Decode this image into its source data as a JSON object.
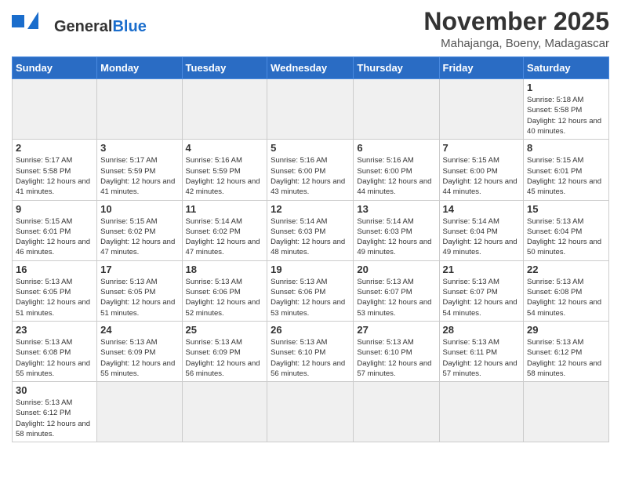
{
  "logo": {
    "text_general": "General",
    "text_blue": "Blue"
  },
  "title": {
    "month_year": "November 2025",
    "location": "Mahajanga, Boeny, Madagascar"
  },
  "weekdays": [
    "Sunday",
    "Monday",
    "Tuesday",
    "Wednesday",
    "Thursday",
    "Friday",
    "Saturday"
  ],
  "weeks": [
    [
      {
        "day": "",
        "info": ""
      },
      {
        "day": "",
        "info": ""
      },
      {
        "day": "",
        "info": ""
      },
      {
        "day": "",
        "info": ""
      },
      {
        "day": "",
        "info": ""
      },
      {
        "day": "",
        "info": ""
      },
      {
        "day": "1",
        "info": "Sunrise: 5:18 AM\nSunset: 5:58 PM\nDaylight: 12 hours and 40 minutes."
      }
    ],
    [
      {
        "day": "2",
        "info": "Sunrise: 5:17 AM\nSunset: 5:58 PM\nDaylight: 12 hours and 41 minutes."
      },
      {
        "day": "3",
        "info": "Sunrise: 5:17 AM\nSunset: 5:59 PM\nDaylight: 12 hours and 41 minutes."
      },
      {
        "day": "4",
        "info": "Sunrise: 5:16 AM\nSunset: 5:59 PM\nDaylight: 12 hours and 42 minutes."
      },
      {
        "day": "5",
        "info": "Sunrise: 5:16 AM\nSunset: 6:00 PM\nDaylight: 12 hours and 43 minutes."
      },
      {
        "day": "6",
        "info": "Sunrise: 5:16 AM\nSunset: 6:00 PM\nDaylight: 12 hours and 44 minutes."
      },
      {
        "day": "7",
        "info": "Sunrise: 5:15 AM\nSunset: 6:00 PM\nDaylight: 12 hours and 44 minutes."
      },
      {
        "day": "8",
        "info": "Sunrise: 5:15 AM\nSunset: 6:01 PM\nDaylight: 12 hours and 45 minutes."
      }
    ],
    [
      {
        "day": "9",
        "info": "Sunrise: 5:15 AM\nSunset: 6:01 PM\nDaylight: 12 hours and 46 minutes."
      },
      {
        "day": "10",
        "info": "Sunrise: 5:15 AM\nSunset: 6:02 PM\nDaylight: 12 hours and 47 minutes."
      },
      {
        "day": "11",
        "info": "Sunrise: 5:14 AM\nSunset: 6:02 PM\nDaylight: 12 hours and 47 minutes."
      },
      {
        "day": "12",
        "info": "Sunrise: 5:14 AM\nSunset: 6:03 PM\nDaylight: 12 hours and 48 minutes."
      },
      {
        "day": "13",
        "info": "Sunrise: 5:14 AM\nSunset: 6:03 PM\nDaylight: 12 hours and 49 minutes."
      },
      {
        "day": "14",
        "info": "Sunrise: 5:14 AM\nSunset: 6:04 PM\nDaylight: 12 hours and 49 minutes."
      },
      {
        "day": "15",
        "info": "Sunrise: 5:13 AM\nSunset: 6:04 PM\nDaylight: 12 hours and 50 minutes."
      }
    ],
    [
      {
        "day": "16",
        "info": "Sunrise: 5:13 AM\nSunset: 6:05 PM\nDaylight: 12 hours and 51 minutes."
      },
      {
        "day": "17",
        "info": "Sunrise: 5:13 AM\nSunset: 6:05 PM\nDaylight: 12 hours and 51 minutes."
      },
      {
        "day": "18",
        "info": "Sunrise: 5:13 AM\nSunset: 6:06 PM\nDaylight: 12 hours and 52 minutes."
      },
      {
        "day": "19",
        "info": "Sunrise: 5:13 AM\nSunset: 6:06 PM\nDaylight: 12 hours and 53 minutes."
      },
      {
        "day": "20",
        "info": "Sunrise: 5:13 AM\nSunset: 6:07 PM\nDaylight: 12 hours and 53 minutes."
      },
      {
        "day": "21",
        "info": "Sunrise: 5:13 AM\nSunset: 6:07 PM\nDaylight: 12 hours and 54 minutes."
      },
      {
        "day": "22",
        "info": "Sunrise: 5:13 AM\nSunset: 6:08 PM\nDaylight: 12 hours and 54 minutes."
      }
    ],
    [
      {
        "day": "23",
        "info": "Sunrise: 5:13 AM\nSunset: 6:08 PM\nDaylight: 12 hours and 55 minutes."
      },
      {
        "day": "24",
        "info": "Sunrise: 5:13 AM\nSunset: 6:09 PM\nDaylight: 12 hours and 55 minutes."
      },
      {
        "day": "25",
        "info": "Sunrise: 5:13 AM\nSunset: 6:09 PM\nDaylight: 12 hours and 56 minutes."
      },
      {
        "day": "26",
        "info": "Sunrise: 5:13 AM\nSunset: 6:10 PM\nDaylight: 12 hours and 56 minutes."
      },
      {
        "day": "27",
        "info": "Sunrise: 5:13 AM\nSunset: 6:10 PM\nDaylight: 12 hours and 57 minutes."
      },
      {
        "day": "28",
        "info": "Sunrise: 5:13 AM\nSunset: 6:11 PM\nDaylight: 12 hours and 57 minutes."
      },
      {
        "day": "29",
        "info": "Sunrise: 5:13 AM\nSunset: 6:12 PM\nDaylight: 12 hours and 58 minutes."
      }
    ],
    [
      {
        "day": "30",
        "info": "Sunrise: 5:13 AM\nSunset: 6:12 PM\nDaylight: 12 hours and 58 minutes."
      },
      {
        "day": "",
        "info": ""
      },
      {
        "day": "",
        "info": ""
      },
      {
        "day": "",
        "info": ""
      },
      {
        "day": "",
        "info": ""
      },
      {
        "day": "",
        "info": ""
      },
      {
        "day": "",
        "info": ""
      }
    ]
  ]
}
